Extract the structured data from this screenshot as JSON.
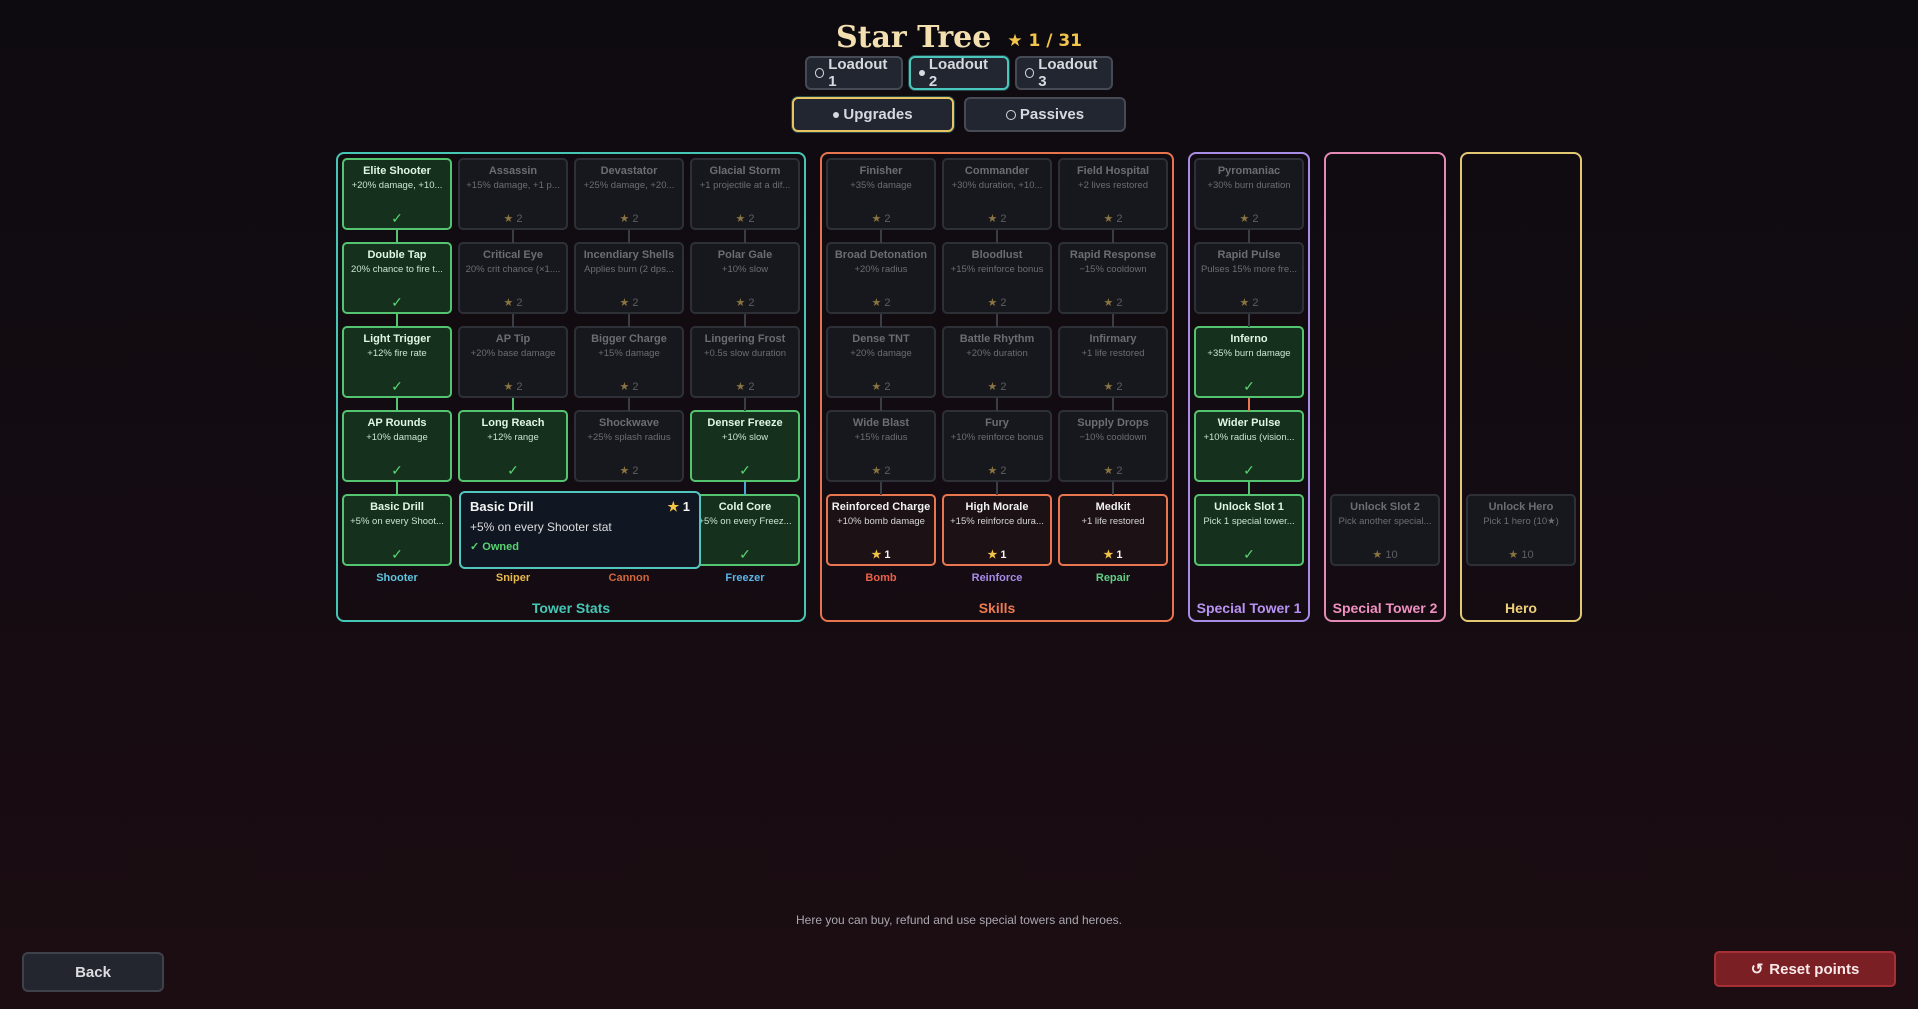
{
  "header": {
    "title": "Star Tree",
    "stars": "★ 1 / 31"
  },
  "loadouts": [
    {
      "label": "Loadout 1",
      "selected": false
    },
    {
      "label": "Loadout 2",
      "selected": true
    },
    {
      "label": "Loadout 3",
      "selected": false
    }
  ],
  "tabs": [
    {
      "label": "Upgrades",
      "selected": true
    },
    {
      "label": "Passives",
      "selected": false
    }
  ],
  "groups": {
    "tower_stats": "Tower Stats",
    "skills": "Skills",
    "special_tower_1": "Special Tower 1",
    "special_tower_2": "Special Tower 2",
    "hero": "Hero"
  },
  "columns": {
    "shooter": {
      "label": "Shooter",
      "color": "#5fc4e0"
    },
    "sniper": {
      "label": "Sniper",
      "color": "#e8b94a"
    },
    "cannon": {
      "label": "Cannon",
      "color": "#d0683c"
    },
    "freezer": {
      "label": "Freezer",
      "color": "#5ab4ea"
    },
    "bomb": {
      "label": "Bomb",
      "color": "#e8614a"
    },
    "reinforce": {
      "label": "Reinforce",
      "color": "#a88be8"
    },
    "repair": {
      "label": "Repair",
      "color": "#5fcf86"
    }
  },
  "nodes": {
    "shooter": [
      {
        "name": "Elite Shooter",
        "desc": "+20% damage, +10...",
        "cost": "✓",
        "state": "owned"
      },
      {
        "name": "Double Tap",
        "desc": "20% chance to fire t...",
        "cost": "✓",
        "state": "owned"
      },
      {
        "name": "Light Trigger",
        "desc": "+12% fire rate",
        "cost": "✓",
        "state": "owned"
      },
      {
        "name": "AP Rounds",
        "desc": "+10% damage",
        "cost": "✓",
        "state": "owned"
      },
      {
        "name": "Basic Drill",
        "desc": "+5% on every Shoot...",
        "cost": "✓",
        "state": "owned"
      }
    ],
    "sniper": [
      {
        "name": "Assassin",
        "desc": "+15% damage, +1 p...",
        "cost": "2",
        "state": "locked"
      },
      {
        "name": "Critical Eye",
        "desc": "20% crit chance (×1....",
        "cost": "2",
        "state": "locked"
      },
      {
        "name": "AP Tip",
        "desc": "+20% base damage",
        "cost": "2",
        "state": "locked"
      },
      {
        "name": "Long Reach",
        "desc": "+12% range",
        "cost": "✓",
        "state": "owned"
      }
    ],
    "cannon": [
      {
        "name": "Devastator",
        "desc": "+25% damage, +20...",
        "cost": "2",
        "state": "locked"
      },
      {
        "name": "Incendiary Shells",
        "desc": "Applies burn (2 dps...",
        "cost": "2",
        "state": "locked"
      },
      {
        "name": "Bigger Charge",
        "desc": "+15% damage",
        "cost": "2",
        "state": "locked"
      },
      {
        "name": "Shockwave",
        "desc": "+25% splash radius",
        "cost": "2",
        "state": "locked"
      }
    ],
    "freezer": [
      {
        "name": "Glacial Storm",
        "desc": "+1 projectile at a dif...",
        "cost": "2",
        "state": "locked"
      },
      {
        "name": "Polar Gale",
        "desc": "+10% slow",
        "cost": "2",
        "state": "locked"
      },
      {
        "name": "Lingering Frost",
        "desc": "+0.5s slow duration",
        "cost": "2",
        "state": "locked"
      },
      {
        "name": "Denser Freeze",
        "desc": "+10% slow",
        "cost": "✓",
        "state": "owned"
      },
      {
        "name": "Cold Core",
        "desc": "+5% on every Freez...",
        "cost": "✓",
        "state": "owned"
      }
    ],
    "bomb": [
      {
        "name": "Finisher",
        "desc": "+35% damage",
        "cost": "2",
        "state": "locked"
      },
      {
        "name": "Broad Detonation",
        "desc": "+20% radius",
        "cost": "2",
        "state": "locked"
      },
      {
        "name": "Dense TNT",
        "desc": "+20% damage",
        "cost": "2",
        "state": "locked"
      },
      {
        "name": "Wide Blast",
        "desc": "+15% radius",
        "cost": "2",
        "state": "locked"
      },
      {
        "name": "Reinforced Charge",
        "desc": "+10% bomb damage",
        "cost": "1",
        "state": "avail"
      }
    ],
    "reinforce": [
      {
        "name": "Commander",
        "desc": "+30% duration, +10...",
        "cost": "2",
        "state": "locked"
      },
      {
        "name": "Bloodlust",
        "desc": "+15% reinforce bonus",
        "cost": "2",
        "state": "locked"
      },
      {
        "name": "Battle Rhythm",
        "desc": "+20% duration",
        "cost": "2",
        "state": "locked"
      },
      {
        "name": "Fury",
        "desc": "+10% reinforce bonus",
        "cost": "2",
        "state": "locked"
      },
      {
        "name": "High Morale",
        "desc": "+15% reinforce dura...",
        "cost": "1",
        "state": "avail"
      }
    ],
    "repair": [
      {
        "name": "Field Hospital",
        "desc": "+2 lives restored",
        "cost": "2",
        "state": "locked"
      },
      {
        "name": "Rapid Response",
        "desc": "−15% cooldown",
        "cost": "2",
        "state": "locked"
      },
      {
        "name": "Infirmary",
        "desc": "+1 life restored",
        "cost": "2",
        "state": "locked"
      },
      {
        "name": "Supply Drops",
        "desc": "−10% cooldown",
        "cost": "2",
        "state": "locked"
      },
      {
        "name": "Medkit",
        "desc": "+1 life restored",
        "cost": "1",
        "state": "avail"
      }
    ],
    "special1": [
      {
        "name": "Pyromaniac",
        "desc": "+30% burn duration",
        "cost": "2",
        "state": "locked"
      },
      {
        "name": "Rapid Pulse",
        "desc": "Pulses 15% more fre...",
        "cost": "2",
        "state": "locked"
      },
      {
        "name": "Inferno",
        "desc": "+35% burn damage",
        "cost": "✓",
        "state": "owned"
      },
      {
        "name": "Wider Pulse",
        "desc": "+10% radius (vision...",
        "cost": "✓",
        "state": "owned"
      },
      {
        "name": "Unlock Slot 1",
        "desc": "Pick 1 special tower...",
        "cost": "✓",
        "state": "owned"
      }
    ],
    "special2": [
      {
        "name": "Unlock Slot 2",
        "desc": "Pick another special...",
        "cost": "10",
        "state": "locked"
      }
    ],
    "hero": [
      {
        "name": "Unlock Hero",
        "desc": "Pick 1 hero (10★)",
        "cost": "10",
        "state": "locked"
      }
    ]
  },
  "tooltip": {
    "name": "Basic Drill",
    "cost": "1",
    "desc": "+5% on every Shooter stat",
    "status": "✓ Owned"
  },
  "hint": "Here you can buy, refund and use special towers and heroes.",
  "buttons": {
    "back": "Back",
    "reset": "Reset points",
    "reset_icon": "↺"
  },
  "icons": {
    "star": "star-icon",
    "check": "check-icon",
    "reset": "reset-icon",
    "radio": "radio-icon"
  },
  "colors": {
    "owned": "#55c470",
    "available": "#e8764f",
    "tower_stats": "#46c7b6",
    "skills": "#e8744e",
    "special1": "#a98ce6",
    "special2": "#e58ab6",
    "hero": "#e2c873",
    "star": "#f2c54a"
  }
}
